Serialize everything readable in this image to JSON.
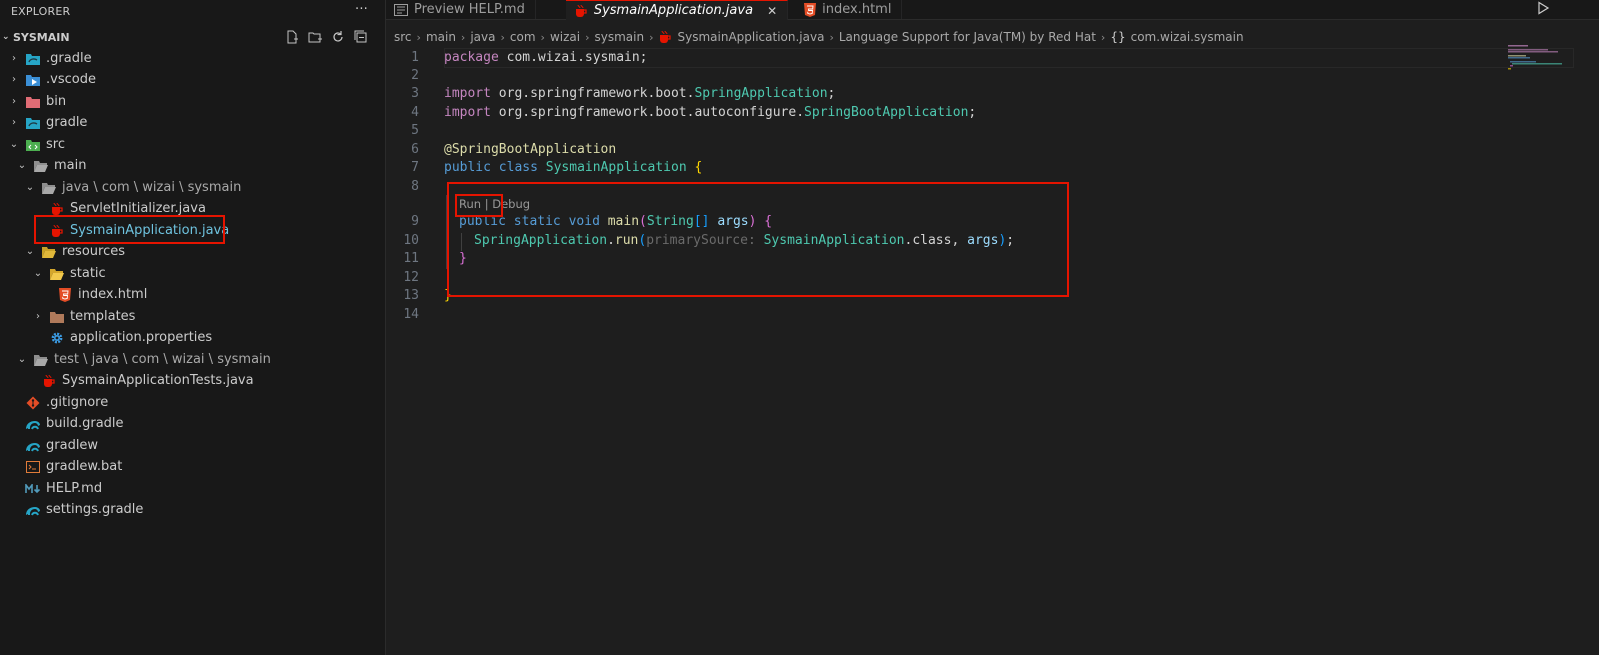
{
  "explorer": {
    "title": "EXPLORER",
    "more": "···",
    "section": "SYSMAIN"
  },
  "tree": [
    {
      "label": "gradle",
      "prefix": ".",
      "kind": "folder-gradle",
      "twisty": "›"
    },
    {
      "label": ".vscode",
      "kind": "folder-vscode",
      "twisty": "›"
    },
    {
      "label": "bin",
      "kind": "folder-bin",
      "twisty": "›"
    },
    {
      "label": "gradle",
      "kind": "folder-gradle",
      "twisty": "›"
    },
    {
      "label": "src",
      "kind": "folder-src",
      "twisty": "⌄"
    },
    {
      "label": "main",
      "kind": "folder-open",
      "twisty": "⌄"
    },
    {
      "label": "java \\ com \\ wizai \\ sysmain",
      "kind": "folder-open",
      "twisty": "⌄"
    },
    {
      "label": "ServletInitializer.java",
      "kind": "java"
    },
    {
      "label": "SysmainApplication.java",
      "kind": "java"
    },
    {
      "label": "resources",
      "kind": "folder-res",
      "twisty": "⌄"
    },
    {
      "label": "static",
      "kind": "folder-yellow",
      "twisty": "⌄"
    },
    {
      "label": "index.html",
      "kind": "html"
    },
    {
      "label": "templates",
      "kind": "folder-tpl",
      "twisty": "›"
    },
    {
      "label": "application.properties",
      "kind": "gear"
    },
    {
      "label": "test \\ java \\ com \\ wizai \\ sysmain",
      "kind": "folder-open",
      "twisty": "⌄"
    },
    {
      "label": "SysmainApplicationTests.java",
      "kind": "java"
    },
    {
      "label": ".gitignore",
      "kind": "git"
    },
    {
      "label": "build.gradle",
      "kind": "gradle"
    },
    {
      "label": "gradlew",
      "kind": "gradle"
    },
    {
      "label": "gradlew.bat",
      "kind": "bat"
    },
    {
      "label": "HELP.md",
      "kind": "md"
    },
    {
      "label": "settings.gradle",
      "kind": "gradle"
    }
  ],
  "tabs": [
    {
      "label": "Preview HELP.md"
    },
    {
      "label": "SysmainApplication.java",
      "close": "✕"
    },
    {
      "label": "index.html"
    }
  ],
  "breadcrumbs": [
    "src",
    "main",
    "java",
    "com",
    "wizai",
    "sysmain",
    "SysmainApplication.java",
    "Language Support for Java(TM) by Red Hat",
    "com.wizai.sysmain"
  ],
  "breadcrumb_braces": "{}",
  "codelens": "Run | Debug",
  "code": {
    "l1": {
      "n": "1",
      "a": "package",
      "b": " com.wizai.sysmain;"
    },
    "l3": {
      "n": "3",
      "a": "import",
      "b": " org.springframework.boot.",
      "c": "SpringApplication",
      "d": ";"
    },
    "l4": {
      "n": "4",
      "a": "import",
      "b": " org.springframework.boot.autoconfigure.",
      "c": "SpringBootApplication",
      "d": ";"
    },
    "l6": {
      "n": "6",
      "a": "@SpringBootApplication"
    },
    "l7": {
      "n": "7",
      "a": "public",
      "b": " ",
      "c": "class",
      "d": " ",
      "e": "SysmainApplication",
      "f": " ",
      "g": "{"
    },
    "l9": {
      "n": "9",
      "a": "public",
      "b": " ",
      "c": "static",
      "d": " ",
      "e": "void",
      "f": " ",
      "g": "main",
      "h": "(",
      "i": "String",
      "j": "[]",
      "k": " ",
      "l": "args",
      ")": ")",
      "m": " ",
      "o": "{"
    },
    "l10": {
      "n": "10",
      "a": "SpringApplication",
      "b": ".",
      "c": "run",
      "d": "(",
      "e": "primarySource:",
      "f": " ",
      "g": "SysmainApplication",
      "h": ".class, ",
      "i": "args",
      "j": ")",
      "k": ";"
    },
    "l11": {
      "n": "11",
      "a": "}"
    },
    "l13": {
      "n": "13",
      "a": "}"
    },
    "blank": [
      "2",
      "5",
      "8",
      "12",
      "14"
    ]
  }
}
